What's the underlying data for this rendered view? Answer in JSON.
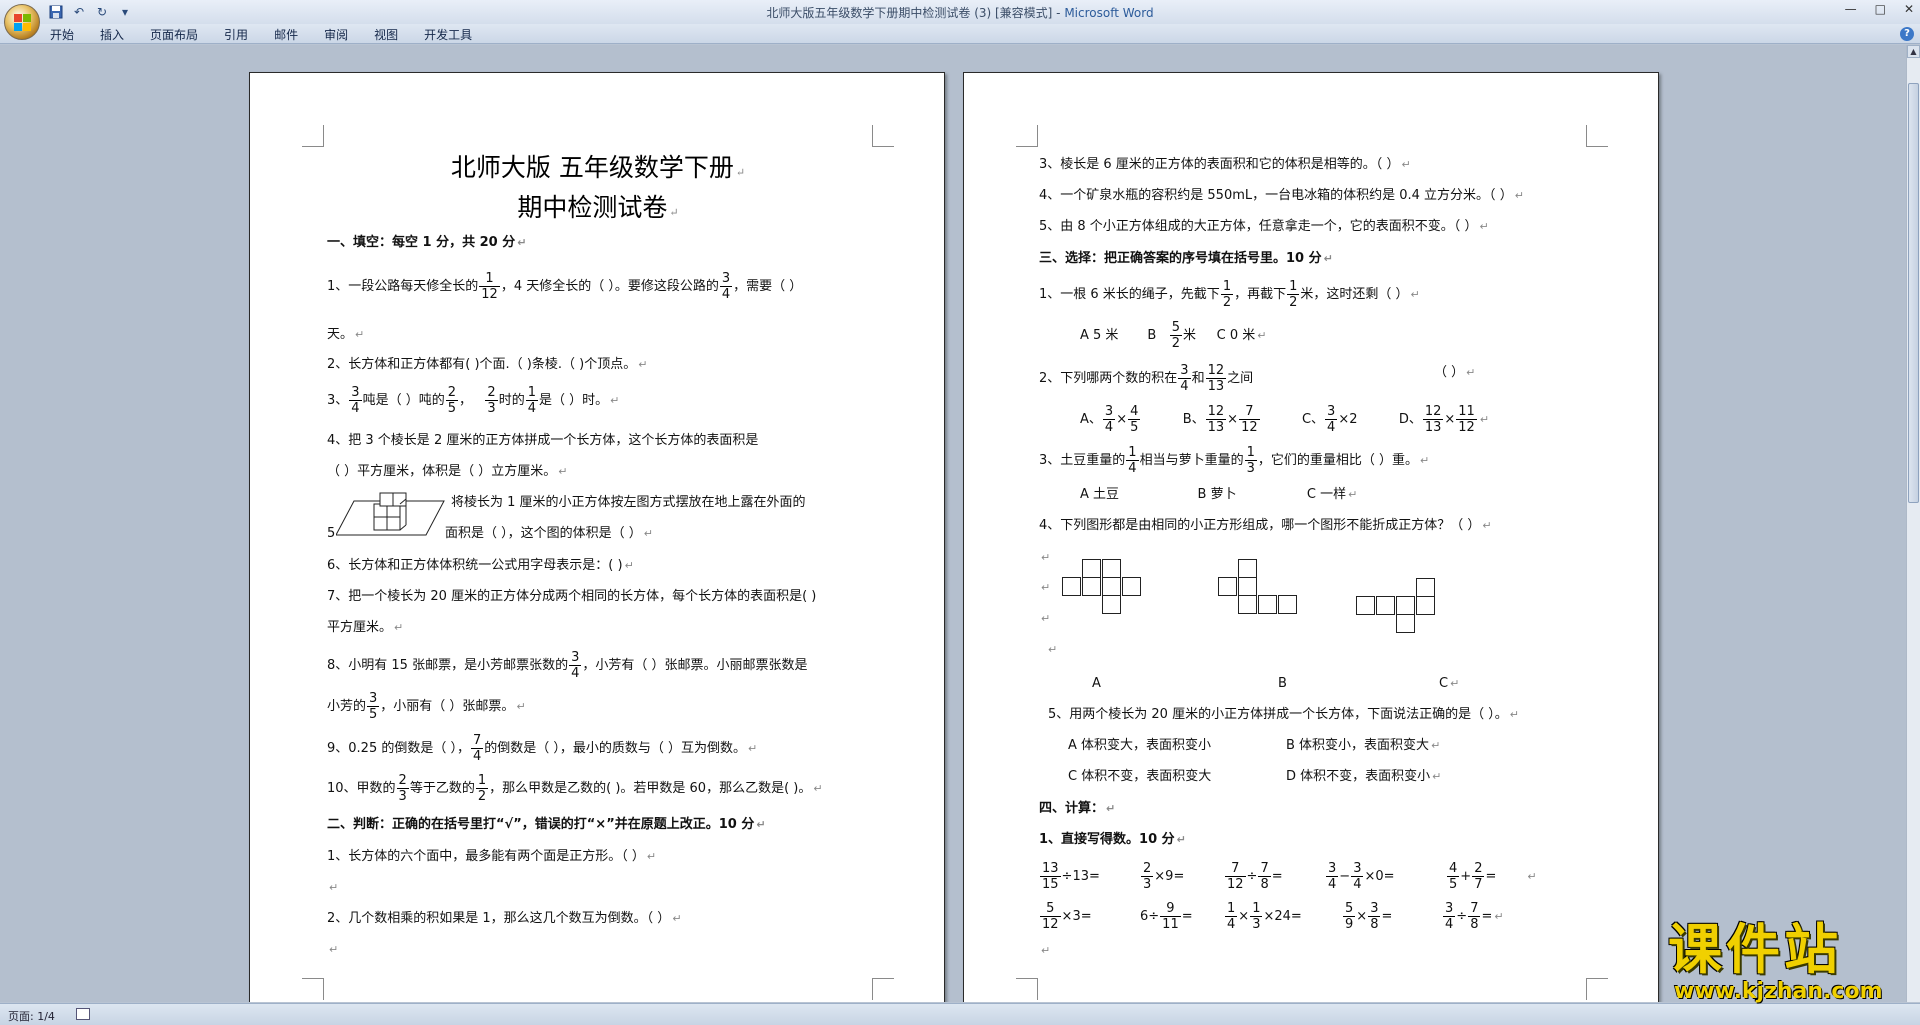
{
  "window": {
    "title_doc": "北师大版五年级数学下册期中检测试卷 (3) [兼容模式] - ",
    "title_app": "Microsoft Word",
    "controls": [
      "—",
      "□",
      "✕"
    ]
  },
  "quick_access": {
    "save": "save-icon",
    "undo": "↶",
    "redo": "↻",
    "customize": "▾"
  },
  "menu": [
    "开始",
    "插入",
    "页面布局",
    "引用",
    "邮件",
    "审阅",
    "视图",
    "开发工具"
  ],
  "status": {
    "page": "页面: 1/4"
  },
  "watermark": {
    "line1": "课件站",
    "line2": "www.kjzhan.com"
  },
  "page1": {
    "title1": "北师大版  五年级数学下册",
    "title2": "期中检测试卷",
    "s1": "一、填空：每空 1 分，共 20 分",
    "q1a": "1、一段公路每天修全长的",
    "f1n": "1",
    "f1d": "12",
    "q1b": "，4 天修全长的（      ）。要修这段公路的",
    "f2n": "3",
    "f2d": "4",
    "q1c": "，需要（    ）",
    "q1d": "天。",
    "q2": "2、长方体和正方体都有(       )个面.（       )条棱.（       )个顶点。",
    "q3a": "3、",
    "f3n": "3",
    "f3d": "4",
    "q3b": "吨是（       ）吨的",
    "f4n": "2",
    "f4d": "5",
    "q3c": "，",
    "f5n": "2",
    "f5d": "3",
    "q3d": "时的",
    "f6n": "1",
    "f6d": "4",
    "q3e": "是（       ）时。",
    "q4a": "4、把 3 个棱长是 2 厘米的正方体拼成一个长方体，这个长方体的表面积是",
    "q4b": "（                    ）平方厘米，体积是（                     ）立方厘米。",
    "q5a": "将棱长为 1 厘米的小正方体按左图方式摆放在地上露在外面的",
    "q5num": "5",
    "q5b": "面积是（          ），这个图的体积是（              ）",
    "q6": "6、长方体和正方体体积统一公式用字母表示是：(                            )",
    "q7a": "7、把一个棱长为 20 厘米的正方体分成两个相同的长方体，每个长方体的表面积是(         )",
    "q7b": "平方厘米。",
    "q8a": "8、小明有 15 张邮票，是小芳邮票张数的",
    "f7n": "3",
    "f7d": "4",
    "q8b": "，小芳有（       ）张邮票。小丽邮票张数是",
    "q8c": "小芳的",
    "f8n": "3",
    "f8d": "5",
    "q8d": "，小丽有（       ）张邮票。",
    "q9a": "9、0.25 的倒数是（       ），",
    "f9n": "7",
    "f9d": "4",
    "q9b": "的倒数是（       ），最小的质数与（       ）互为倒数。",
    "q10a": "10、甲数的",
    "f10n": "2",
    "f10d": "3",
    "q10b": "等于乙数的",
    "f11n": "1",
    "f11d": "2",
    "q10c": "，那么甲数是乙数的(       )。若甲数是 60，那么乙数是(        )。",
    "s2": "二、判断：正确的在括号里打“√”，错误的打“×”并在原题上改正。10 分",
    "j1": "1、长方体的六个面中，最多能有两个面是正方形。（       ）",
    "j2": "2、几个数相乘的积如果是 1，那么这几个数互为倒数。（       ）"
  },
  "page2": {
    "j3": "3、棱长是 6 厘米的正方体的表面积和它的体积是相等的。（        ）",
    "j4": "4、一个矿泉水瓶的容积约是 550mL，一台电冰箱的体积约是 0.4 立方分米。（        ）",
    "j5": "5、由 8 个小正方体组成的大正方体，任意拿走一个，它的表面积不变。（        ）",
    "s3": "三、选择：把正确答案的序号填在括号里。10 分",
    "c1a": "1、一根 6 米长的绳子，先截下",
    "c1fn": "1",
    "c1fd": "2",
    "c1b": "，再截下",
    "c1gn": "1",
    "c1gd": "2",
    "c1c": "米，这时还剩（       ）",
    "c1A": "A    5 米",
    "c1B": "B",
    "c1Bn": "5",
    "c1Bd": "2",
    "c1Bu": "米",
    "c1C": "C    0 米",
    "c2a": "2、下列哪两个数的积在",
    "c2fn": "3",
    "c2fd": "4",
    "c2b": "和",
    "c2gn": "12",
    "c2gd": "13",
    "c2c": "之间",
    "c2blank": "（       ）",
    "oA": "A、",
    "oAn1": "3",
    "oAd1": "4",
    "oAop": "×",
    "oAn2": "4",
    "oAd2": "5",
    "oB": "B、",
    "oBn1": "12",
    "oBd1": "13",
    "oBop": "×",
    "oBn2": "7",
    "oBd2": "12",
    "oC": "C、",
    "oCn1": "3",
    "oCd1": "4",
    "oCop": "×2",
    "oD": "D、",
    "oDn1": "12",
    "oDd1": "13",
    "oDop": "×",
    "oDn2": "11",
    "oDd2": "12",
    "c3a": "3、土豆重量的",
    "c3fn": "1",
    "c3fd": "4",
    "c3b": "相当与萝卜重量的",
    "c3gn": "1",
    "c3gd": "3",
    "c3c": "，它们的重量相比（        ）重。",
    "c3A": "A    土豆",
    "c3B": "B    萝卜",
    "c3C": "C    一样",
    "c4": "4、下列图形都是由相同的小正方形组成，哪一个图形不能折成正方体？（    ）",
    "netA": "A",
    "netB": "B",
    "netC": "C",
    "c5": "5、用两个棱长为 20 厘米的小正方体拼成一个长方体，下面说法正确的是（        ）。",
    "c5A": "A 体积变大，表面积变小",
    "c5B": "B 体积变小，表面积变大",
    "c5C": "C 体积不变，表面积变大",
    "c5D": "D 体积不变，表面积变小",
    "s4": "四、计算：",
    "s41": "1、直接写得数。10 分",
    "e1n": "13",
    "e1d": "15",
    "e1t": "÷13=",
    "e2n": "2",
    "e2d": "3",
    "e2t": "×9=",
    "e3n": "7",
    "e3d": "12",
    "e3o": "÷",
    "e3n2": "7",
    "e3d2": "8",
    "e3t": "=",
    "e4n": "3",
    "e4d": "4",
    "e4o": "−",
    "e4n2": "3",
    "e4d2": "4",
    "e4t": "×0=",
    "e5n": "4",
    "e5d": "5",
    "e5o": "+",
    "e5n2": "2",
    "e5d2": "7",
    "e5t": "=",
    "e6n": "5",
    "e6d": "12",
    "e6t": "×3=",
    "e7p": "6÷",
    "e7n": "9",
    "e7d": "11",
    "e7t": "=",
    "e8n": "1",
    "e8d": "4",
    "e8o": "×",
    "e8n2": "1",
    "e8d2": "3",
    "e8t": "×24=",
    "e9n": "5",
    "e9d": "9",
    "e9o": "×",
    "e9n2": "3",
    "e9d2": "8",
    "e9t": "=",
    "e10n": "3",
    "e10d": "4",
    "e10o": "÷",
    "e10n2": "7",
    "e10d2": "8",
    "e10t": "="
  }
}
